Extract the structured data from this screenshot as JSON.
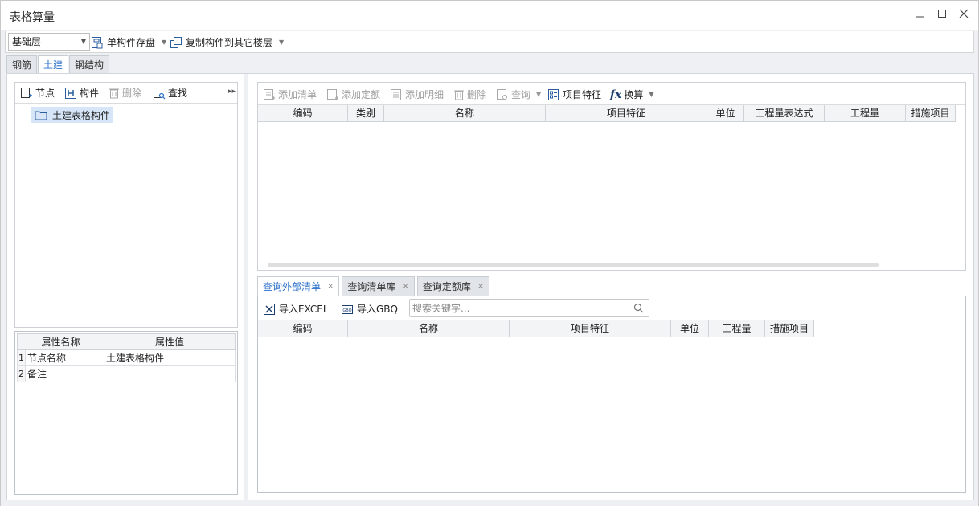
{
  "window": {
    "title": "表格算量"
  },
  "toolbar": {
    "floor_select": "基础层",
    "save_component": "单构件存盘",
    "copy_component": "复制构件到其它楼层"
  },
  "top_tabs": [
    {
      "label": "钢筋"
    },
    {
      "label": "土建"
    },
    {
      "label": "钢结构"
    }
  ],
  "left_toolbar": {
    "node": "节点",
    "component": "构件",
    "delete": "删除",
    "find": "查找"
  },
  "tree": {
    "root": "土建表格构件"
  },
  "properties": {
    "headers": [
      "属性名称",
      "属性值"
    ],
    "rows": [
      {
        "idx": "1",
        "name": "节点名称",
        "value": "土建表格构件"
      },
      {
        "idx": "2",
        "name": "备注",
        "value": ""
      }
    ]
  },
  "right_toolbar": {
    "add_list": "添加清单",
    "add_quota": "添加定额",
    "add_detail": "添加明细",
    "delete": "删除",
    "query": "查询",
    "item_feature": "项目特征",
    "convert": "换算"
  },
  "top_grid": {
    "columns": [
      "编码",
      "类别",
      "名称",
      "项目特征",
      "单位",
      "工程量表达式",
      "工程量",
      "措施项目"
    ]
  },
  "bottom_tabs": [
    {
      "label": "查询外部清单"
    },
    {
      "label": "查询清单库"
    },
    {
      "label": "查询定额库"
    }
  ],
  "bottom_toolbar": {
    "import_excel": "导入EXCEL",
    "import_gbq": "导入GBQ",
    "search_placeholder": "搜索关键字..."
  },
  "bottom_grid": {
    "columns": [
      "编码",
      "名称",
      "项目特征",
      "单位",
      "工程量",
      "措施项目"
    ]
  },
  "colors": {
    "accent": "#2a6fc9",
    "selection": "#d6e6f8"
  }
}
